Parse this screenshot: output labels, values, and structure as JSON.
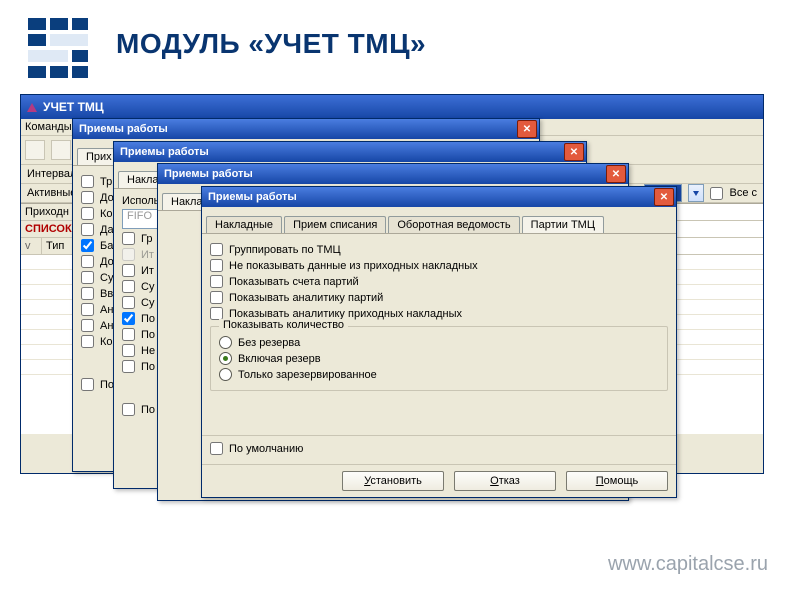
{
  "page": {
    "title": "МОДУЛЬ «УЧЕТ ТМЦ»",
    "footer": "www.capitalcse.ru"
  },
  "mainwin": {
    "title": "УЧЕТ ТМЦ",
    "menubar": "Команды",
    "tab_main": "Наклад",
    "row_interval": "Интервал",
    "row_active": "Активные",
    "all_checkbox": "Все с",
    "grid": {
      "col1": "Приходн",
      "col2": "СПИСОК",
      "col3": "Тип",
      "col3_prefix": "v"
    }
  },
  "dialog": {
    "title": "Приемы работы",
    "stack1_tab": "Прих",
    "stack2_tab": "Наклад",
    "stack2_label": "Использу",
    "stack2_field": "FIFO",
    "stack3_tab": "Наклад",
    "tabs": {
      "t1": "Накладные",
      "t2": "Прием списания",
      "t3": "Оборотная ведомость",
      "t4": "Партии ТМЦ"
    },
    "checks": {
      "c1": "Группировать по ТМЦ",
      "c2": "Не показывать данные из приходных накладных",
      "c3": "Показывать счета партий",
      "c4": "Показывать аналитику партий",
      "c5": "Показывать аналитику приходных накладных"
    },
    "groupTitle": "Показывать количество",
    "radios": {
      "r1": "Без резерва",
      "r2": "Включая резерв",
      "r3": "Только зарезервированное"
    },
    "default_chk": "По умолчанию",
    "stack_chk_pou": "По у",
    "stack_chk_poum": "По ум",
    "buttons": {
      "install": "становить",
      "install_u": "У",
      "cancel": "тказ",
      "cancel_u": "О",
      "help": "омощь",
      "help_u": "П"
    },
    "partial_checks": {
      "a1": "Тр",
      "a2": "До",
      "a3": "Ко",
      "a4": "Да",
      "a5": "Ба",
      "a6": "До",
      "a7": "Су",
      "a8": "Вв",
      "a9": "Ан",
      "a10": "Ан",
      "a11": "Ко",
      "b1": "Гр",
      "b2": "Ит",
      "b3": "Ит",
      "b4": "Су",
      "b5": "Су",
      "b6": "По",
      "b7": "По",
      "b8": "Не",
      "b9": "По"
    }
  }
}
